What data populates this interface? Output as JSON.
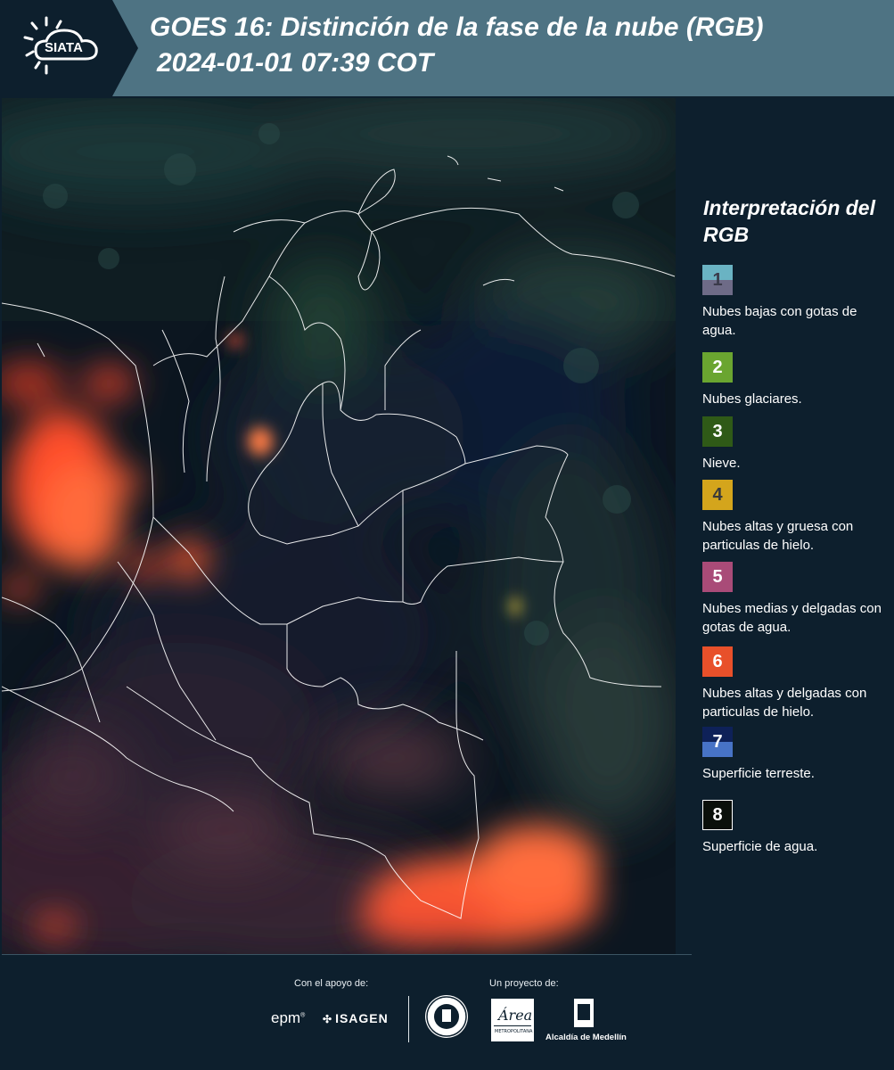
{
  "header": {
    "logo_text": "SIATA",
    "title_line1": "GOES 16: Distinción de la fase de la nube (RGB)",
    "title_line2": "2024-01-01 07:39 COT"
  },
  "legend": {
    "title": "Interpretación del RGB",
    "items": [
      {
        "num": "1",
        "text": "Nubes bajas con gotas de agua.",
        "top_color": "#6ab3c3",
        "bottom_color": "#6e6b87",
        "num_color": "#3a3a4a"
      },
      {
        "num": "2",
        "text": "Nubes glaciares.",
        "top_color": "#6aa530",
        "bottom_color": "#6aa530",
        "num_color": "#ffffff"
      },
      {
        "num": "3",
        "text": "Nieve.",
        "top_color": "#2f5a17",
        "bottom_color": "#2f5a17",
        "num_color": "#ffffff"
      },
      {
        "num": "4",
        "text": "Nubes altas y gruesa con particulas de hielo.",
        "top_color": "#d4a51c",
        "bottom_color": "#d4a51c",
        "num_color": "#3a3a3a"
      },
      {
        "num": "5",
        "text": "Nubes medias y delgadas con gotas de agua.",
        "top_color": "#a94b78",
        "bottom_color": "#a94b78",
        "num_color": "#ffffff"
      },
      {
        "num": "6",
        "text": "Nubes altas y delgadas con particulas de hielo.",
        "top_color": "#e8502a",
        "bottom_color": "#e8502a",
        "num_color": "#ffffff"
      },
      {
        "num": "7",
        "text": "Superficie terreste.",
        "top_color": "#0e2158",
        "bottom_color": "#4773c6",
        "num_color": "#ffffff"
      },
      {
        "num": "8",
        "text": "Superficie de agua.",
        "top_color": "#0a0f0a",
        "bottom_color": "#0a0f0a",
        "num_color": "#ffffff"
      }
    ]
  },
  "footer": {
    "support_label": "Con el apoyo de:",
    "project_label": "Un proyecto de:",
    "epm_text": "epm",
    "isagen_text": "ISAGEN",
    "alcaldia_text": "Alcaldía de Medellín"
  },
  "colors": {
    "header_bg": "#4e7383",
    "page_bg": "#0d1f2d",
    "cloud_ice": "#ff5a30",
    "border_line": "#ffffff"
  }
}
